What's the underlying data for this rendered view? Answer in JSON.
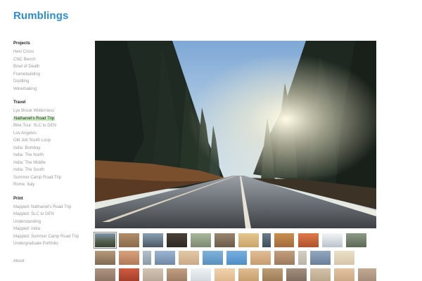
{
  "site": {
    "title": "Rumblings"
  },
  "sidebar": {
    "sections": [
      {
        "heading": "Projects",
        "items": [
          "Hexi Cross",
          "CNC Bench",
          "Bowl of Death",
          "Framebuilding",
          "Distilling",
          "Winemaking"
        ]
      },
      {
        "heading": "Travel",
        "items": [
          "Lye Brook Wilderness",
          "Nathaniel's Road Trip",
          "Bike Tour: SLC to DEN",
          "Los Angeles",
          "Old Job South Loop",
          "India: Bombay",
          "India: The North",
          "India: The Middle",
          "India: The South",
          "Summer Camp Road Trip",
          "Rome, Italy"
        ],
        "active_index": 1
      },
      {
        "heading": "Print",
        "items": [
          "Mapped: Nathaniel's Road Trip",
          "Mapped: SLC to DEN",
          "Understanding",
          "Mapped: India",
          "Mapped: Summer Camp Road Trip",
          "Undergraduate Portfolio"
        ]
      }
    ],
    "about": "About"
  },
  "colors": {
    "title": "#2a8fd4",
    "active_highlight": "#c9ecc0"
  },
  "hero": {
    "icon": "forest-road-photo"
  },
  "thumbnails": {
    "rows": [
      [
        "#56614e",
        "#8b6a4c",
        "#4c5763",
        "#2f2a24",
        "#7b8a70",
        "#6a5a48",
        "#caa56a",
        "#3c4d5e",
        "#a46a3e",
        "#b0522e",
        "#dfe4e8",
        "#5b6a55"
      ],
      [
        "#7f6a52",
        "#b27a58",
        "#8d9aa6",
        "#6f87a3",
        "#c9a885",
        "#5a90bf",
        "#4f8ec6",
        "#c79b70",
        "#9c7a5d",
        "#b8b3a7",
        "#6a7f99",
        "#d5c6a7"
      ],
      [
        "#8a7060",
        "#a03d2a",
        "#b5a493",
        "#9a7a62",
        "#cfd6da",
        "#dcb58a",
        "#c59b6a",
        "#9a7a55",
        "#7d6a5a",
        "#b8a488",
        "#caa582",
        "#a38a76"
      ]
    ],
    "selected_index": 0
  }
}
